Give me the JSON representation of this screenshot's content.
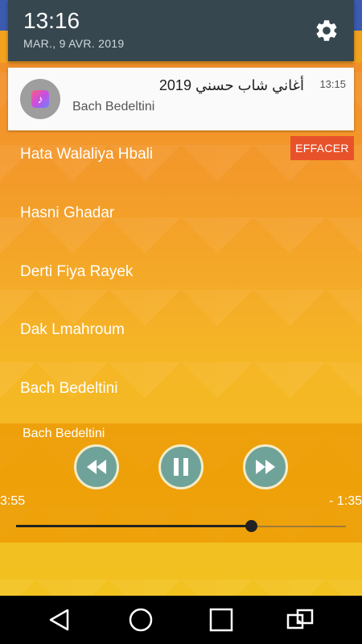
{
  "status": {
    "time": "13:16",
    "date": "MAR., 9 AVR. 2019"
  },
  "notification": {
    "title": "أغاني شاب حسني 2019",
    "time": "13:15",
    "subtitle": "Bach Bedeltini",
    "clear_label": "EFFACER"
  },
  "songs": [
    "Hata Walaliya Hbali",
    "Hasni Ghadar",
    "Derti Fiya Rayek",
    "Dak Lmahroum",
    "Bach Bedeltini"
  ],
  "player": {
    "now_playing": "Bach Bedeltini",
    "elapsed": "3:55",
    "remaining": "- 1:35",
    "progress": 0.711
  },
  "colors": {
    "shade": "#37474f",
    "clear_button": "#e8522a",
    "control": "#6fa39a"
  },
  "icons": [
    "gear-icon",
    "music-app-icon",
    "previous-icon",
    "pause-icon",
    "next-icon",
    "back-icon",
    "home-icon",
    "recents-icon",
    "rotate-icon"
  ]
}
